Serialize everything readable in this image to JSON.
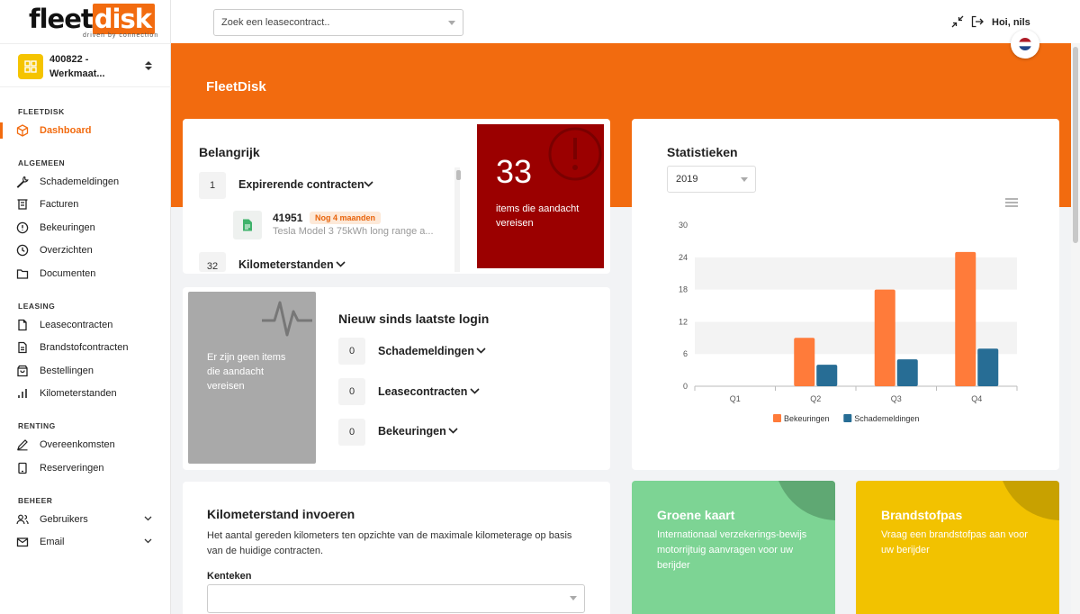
{
  "brand": {
    "logo_left": "fleet",
    "logo_right": "disk",
    "tagline": "driven by connection",
    "accent": "#f26b0f"
  },
  "company": {
    "name_line1": "400822 -",
    "name_line2": "Werkmaat..."
  },
  "sidebar": {
    "sections": [
      {
        "title": "FLEETDISK"
      },
      {
        "title": "ALGEMEEN"
      },
      {
        "title": "LEASING"
      },
      {
        "title": "RENTING"
      },
      {
        "title": "BEHEER"
      }
    ],
    "items": [
      {
        "label": "Dashboard",
        "icon": "cube-icon",
        "active": true
      },
      {
        "label": "Schademeldingen",
        "icon": "wrench-icon"
      },
      {
        "label": "Facturen",
        "icon": "invoice-icon"
      },
      {
        "label": "Bekeuringen",
        "icon": "alert-circle-icon"
      },
      {
        "label": "Overzichten",
        "icon": "clock-icon"
      },
      {
        "label": "Documenten",
        "icon": "folder-icon"
      },
      {
        "label": "Leasecontracten",
        "icon": "file-icon"
      },
      {
        "label": "Brandstofcontracten",
        "icon": "file-text-icon"
      },
      {
        "label": "Bestellingen",
        "icon": "shopping-bag-icon"
      },
      {
        "label": "Kilometerstanden",
        "icon": "bar-chart-icon"
      },
      {
        "label": "Overeenkomsten",
        "icon": "pen-icon"
      },
      {
        "label": "Reserveringen",
        "icon": "tablet-icon"
      },
      {
        "label": "Gebruikers",
        "icon": "users-icon"
      },
      {
        "label": "Email",
        "icon": "mail-icon"
      }
    ]
  },
  "header": {
    "search_placeholder": "Zoek een leasecontract..",
    "greeting": "Hoi, nils"
  },
  "hero": {
    "title": "FleetDisk"
  },
  "important": {
    "title": "Belangrijk",
    "rows": [
      {
        "count": "1",
        "label": "Expirerende contracten"
      },
      {
        "count": "32",
        "label": "Kilometerstanden"
      }
    ],
    "contract": {
      "number": "41951",
      "badge": "Nog 4 maanden",
      "description": "Tesla Model 3 75kWh long range a..."
    },
    "alert": {
      "count": "33",
      "text": "items die aandacht vereisen",
      "color": "#9b0000"
    }
  },
  "new_since_login": {
    "title": "Nieuw sinds laatste login",
    "empty_text": "Er zijn geen items die aandacht vereisen",
    "rows": [
      {
        "count": "0",
        "label": "Schademeldingen"
      },
      {
        "count": "0",
        "label": "Leasecontracten"
      },
      {
        "count": "0",
        "label": "Bekeuringen"
      }
    ]
  },
  "stats": {
    "title": "Statistieken",
    "year": "2019"
  },
  "chart_data": {
    "type": "bar",
    "categories": [
      "Q1",
      "Q2",
      "Q3",
      "Q4"
    ],
    "series": [
      {
        "name": "Bekeuringen",
        "values": [
          0,
          9,
          18,
          25
        ],
        "color": "#ff7b3a"
      },
      {
        "name": "Schademeldingen",
        "values": [
          0,
          4,
          5,
          7
        ],
        "color": "#276d95"
      }
    ],
    "yticks": [
      0,
      6,
      12,
      18,
      24,
      30
    ],
    "ylim": [
      0,
      30
    ],
    "title": "",
    "xlabel": "",
    "ylabel": "",
    "grid": "horizontal bands",
    "legend": "bottom-center"
  },
  "mileage": {
    "title": "Kilometerstand invoeren",
    "description": "Het aantal gereden kilometers ten opzichte van de maximale kilometerage op basis van de huidige contracten.",
    "field_label": "Kenteken"
  },
  "promos": [
    {
      "title": "Groene kaart",
      "text": "Internationaal verzekerings-bewijs motorrijtuig aanvragen voor uw berijder",
      "color": "#7dd494"
    },
    {
      "title": "Brandstofpas",
      "text": "Vraag een brandstofpas aan voor uw berijder",
      "color": "#f2c200"
    }
  ]
}
